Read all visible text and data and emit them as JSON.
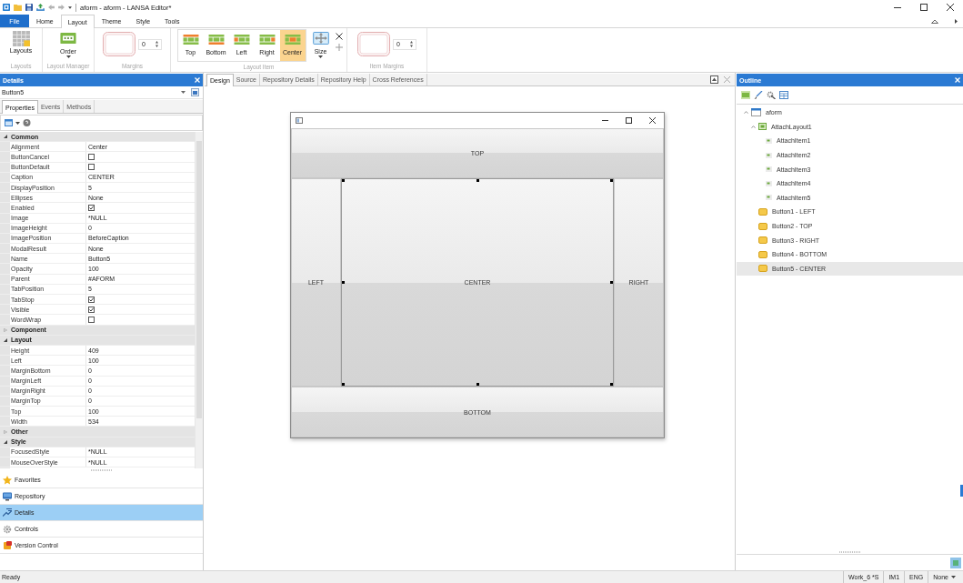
{
  "window": {
    "title": "aform - aform - LANSA Editor*"
  },
  "menu_tabs": [
    {
      "label": "File",
      "kind": "file",
      "selected": false
    },
    {
      "label": "Home",
      "kind": "tab",
      "selected": false
    },
    {
      "label": "Layout",
      "kind": "tab",
      "selected": true
    },
    {
      "label": "Theme",
      "kind": "tab",
      "selected": false
    },
    {
      "label": "Style",
      "kind": "tab",
      "selected": false
    },
    {
      "label": "Tools",
      "kind": "tab",
      "selected": false
    }
  ],
  "ribbon": {
    "groups": [
      {
        "label": "Layouts",
        "controls": [
          {
            "kind": "layouts",
            "label": "Layouts"
          }
        ]
      },
      {
        "label": "Layout Manager",
        "controls": [
          {
            "kind": "order",
            "label": "Order"
          }
        ]
      },
      {
        "label": "Margins",
        "controls": [
          {
            "kind": "margins",
            "value": "0"
          }
        ]
      },
      {
        "label": "Layout Item",
        "controls": [
          {
            "kind": "position",
            "label": "Top",
            "selected": false
          },
          {
            "kind": "position",
            "label": "Bottom",
            "selected": false
          },
          {
            "kind": "position",
            "label": "Left",
            "selected": false
          },
          {
            "kind": "position",
            "label": "Right",
            "selected": false
          },
          {
            "kind": "position",
            "label": "Center",
            "selected": true
          },
          {
            "kind": "size",
            "label": "Size"
          },
          {
            "kind": "edit"
          }
        ]
      },
      {
        "label": "Item Margins",
        "controls": [
          {
            "kind": "margins",
            "value": "0"
          }
        ]
      }
    ]
  },
  "details_panel": {
    "title": "Details",
    "object": "Button5",
    "tabs": [
      {
        "label": "Properties",
        "selected": true
      },
      {
        "label": "Events",
        "selected": false
      },
      {
        "label": "Methods",
        "selected": false
      }
    ],
    "categories": [
      {
        "name": "Common",
        "expanded": true,
        "properties": [
          {
            "name": "Alignment",
            "kind": "text",
            "value": "Center"
          },
          {
            "name": "ButtonCancel",
            "kind": "checkbox",
            "checked": false
          },
          {
            "name": "ButtonDefault",
            "kind": "checkbox",
            "checked": false
          },
          {
            "name": "Caption",
            "kind": "text",
            "value": "CENTER"
          },
          {
            "name": "DisplayPosition",
            "kind": "text",
            "value": "5"
          },
          {
            "name": "Ellipses",
            "kind": "text",
            "value": "None"
          },
          {
            "name": "Enabled",
            "kind": "checkbox",
            "checked": true
          },
          {
            "name": "Image",
            "kind": "text",
            "value": "*NULL"
          },
          {
            "name": "ImageHeight",
            "kind": "text",
            "value": "0"
          },
          {
            "name": "ImagePosition",
            "kind": "text",
            "value": "BeforeCaption"
          },
          {
            "name": "ModalResult",
            "kind": "text",
            "value": "None"
          },
          {
            "name": "Name",
            "kind": "text",
            "value": "Button5"
          },
          {
            "name": "Opacity",
            "kind": "text",
            "value": "100"
          },
          {
            "name": "Parent",
            "kind": "text",
            "value": "#AFORM"
          },
          {
            "name": "TabPosition",
            "kind": "text",
            "value": "5"
          },
          {
            "name": "TabStop",
            "kind": "checkbox",
            "checked": true
          },
          {
            "name": "Visible",
            "kind": "checkbox",
            "checked": true
          },
          {
            "name": "WordWrap",
            "kind": "checkbox",
            "checked": false
          }
        ]
      },
      {
        "name": "Component",
        "expanded": false
      },
      {
        "name": "Layout",
        "expanded": true,
        "properties": [
          {
            "name": "Height",
            "kind": "text",
            "value": "409"
          },
          {
            "name": "Left",
            "kind": "text",
            "value": "100"
          },
          {
            "name": "MarginBottom",
            "kind": "text",
            "value": "0"
          },
          {
            "name": "MarginLeft",
            "kind": "text",
            "value": "0"
          },
          {
            "name": "MarginRight",
            "kind": "text",
            "value": "0"
          },
          {
            "name": "MarginTop",
            "kind": "text",
            "value": "0"
          },
          {
            "name": "Top",
            "kind": "text",
            "value": "100"
          },
          {
            "name": "Width",
            "kind": "text",
            "value": "534"
          }
        ]
      },
      {
        "name": "Other",
        "expanded": false
      },
      {
        "name": "Style",
        "expanded": true,
        "properties": [
          {
            "name": "FocusedStyle",
            "kind": "text",
            "value": "*NULL"
          },
          {
            "name": "MouseOverStyle",
            "kind": "text",
            "value": "*NULL"
          }
        ]
      }
    ]
  },
  "navigation": [
    {
      "label": "Favorites",
      "selected": false
    },
    {
      "label": "Repository",
      "selected": false
    },
    {
      "label": "Details",
      "selected": true
    },
    {
      "label": "Controls",
      "selected": false
    },
    {
      "label": "Version Control",
      "selected": false
    }
  ],
  "editor": {
    "tabs": [
      {
        "label": "Design",
        "selected": true
      },
      {
        "label": "Source",
        "selected": false
      },
      {
        "label": "Repository Details",
        "selected": false
      },
      {
        "label": "Repository Help",
        "selected": false
      },
      {
        "label": "Cross References",
        "selected": false
      }
    ],
    "form": {
      "buttons": [
        {
          "caption": "TOP",
          "kind": "top",
          "selected": false
        },
        {
          "caption": "LEFT",
          "kind": "left",
          "selected": false
        },
        {
          "caption": "CENTER",
          "kind": "center",
          "selected": true
        },
        {
          "caption": "RIGHT",
          "kind": "right",
          "selected": false
        },
        {
          "caption": "BOTTOM",
          "kind": "bottom",
          "selected": false
        }
      ]
    }
  },
  "outline": {
    "title": "Outline",
    "tree": [
      {
        "label": "aform",
        "kind": "form",
        "expanded": true,
        "selected": false,
        "children": [
          {
            "label": "AttachLayout1",
            "kind": "layout",
            "expanded": true,
            "selected": false,
            "children": [
              {
                "label": "AttachItem1",
                "kind": "item",
                "selected": false
              },
              {
                "label": "AttachItem2",
                "kind": "item",
                "selected": false
              },
              {
                "label": "AttachItem3",
                "kind": "item",
                "selected": false
              },
              {
                "label": "AttachItem4",
                "kind": "item",
                "selected": false
              },
              {
                "label": "AttachItem5",
                "kind": "item",
                "selected": false
              }
            ]
          },
          {
            "label": "Button1 - LEFT",
            "kind": "button",
            "selected": false
          },
          {
            "label": "Button2 - TOP",
            "kind": "button",
            "selected": false
          },
          {
            "label": "Button3 - RIGHT",
            "kind": "button",
            "selected": false
          },
          {
            "label": "Button4 - BOTTOM",
            "kind": "button",
            "selected": false
          },
          {
            "label": "Button5 - CENTER",
            "kind": "button",
            "selected": true
          }
        ]
      }
    ]
  },
  "status_bar": {
    "message": "Ready",
    "indicators": [
      {
        "text": "Work_6 *S",
        "kind": "label"
      },
      {
        "text": "IM1",
        "kind": "label"
      },
      {
        "text": "ENG",
        "kind": "label"
      },
      {
        "text": "None",
        "kind": "dropdown"
      }
    ]
  }
}
